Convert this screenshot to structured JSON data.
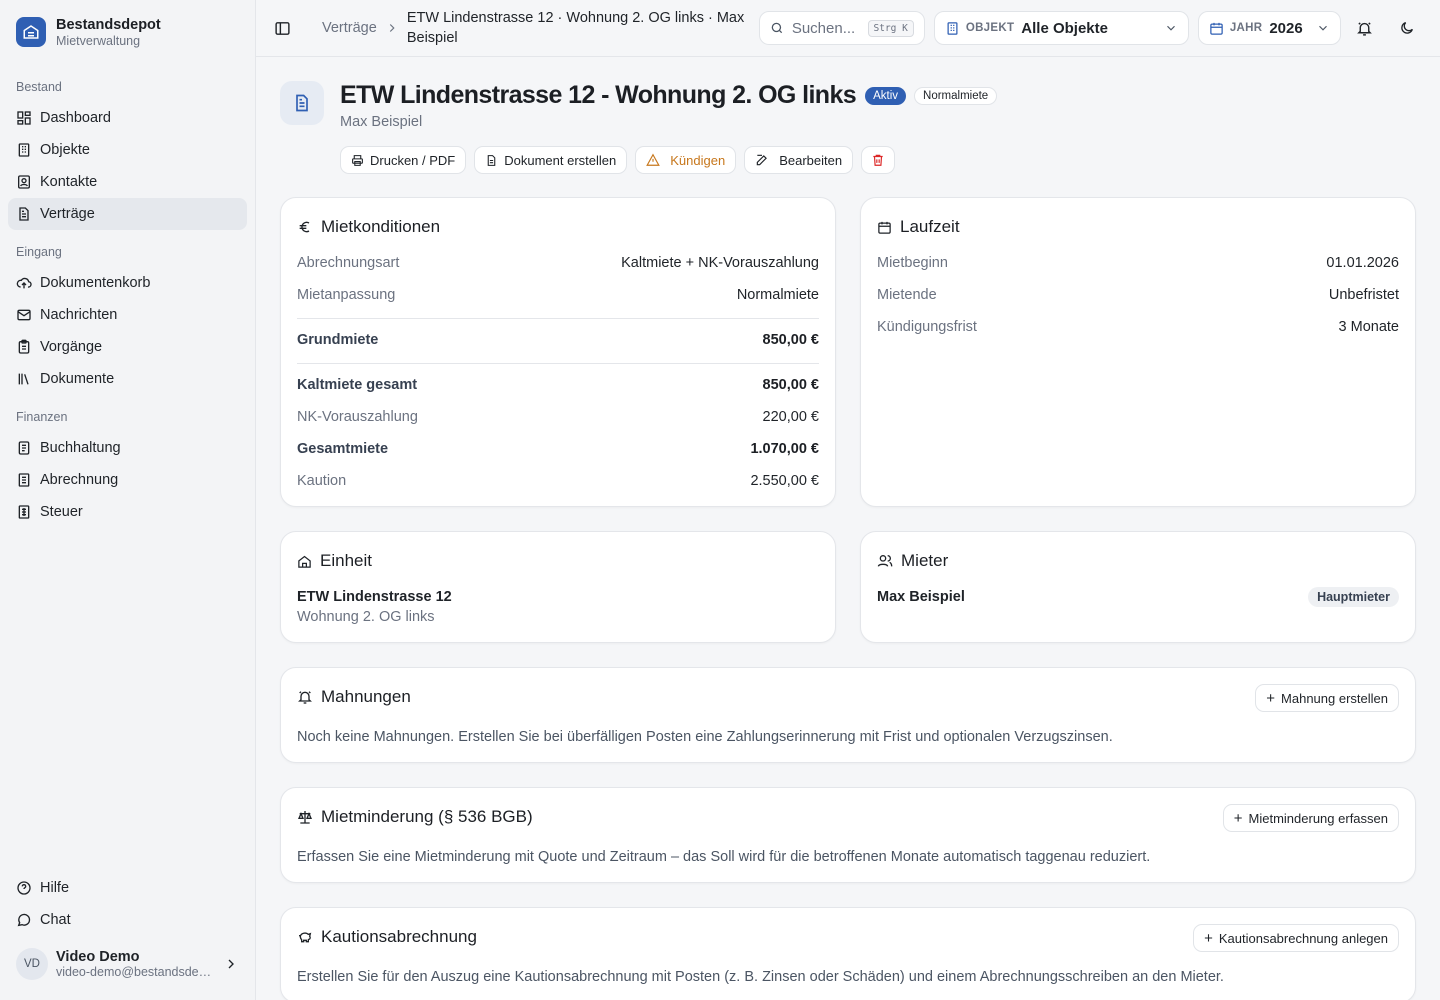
{
  "brand": {
    "title": "Bestandsdepot",
    "subtitle": "Mietverwaltung"
  },
  "nav": {
    "sections": [
      {
        "label": "Bestand",
        "items": [
          "Dashboard",
          "Objekte",
          "Kontakte",
          "Verträge"
        ]
      },
      {
        "label": "Eingang",
        "items": [
          "Dokumentenkorb",
          "Nachrichten",
          "Vorgänge",
          "Dokumente"
        ]
      },
      {
        "label": "Finanzen",
        "items": [
          "Buchhaltung",
          "Abrechnung",
          "Steuer"
        ]
      }
    ],
    "bottom": [
      "Hilfe",
      "Chat"
    ]
  },
  "user": {
    "initials": "VD",
    "name": "Video Demo",
    "email": "video-demo@bestandsdepot.de"
  },
  "topbar": {
    "breadcrumb": [
      "Verträge",
      "ETW Lindenstrasse 12 · Wohnung 2. OG links · Max Beispiel"
    ],
    "search_placeholder": "Suchen...",
    "search_shortcut": "Strg K",
    "object_label": "OBJEKT",
    "object_value": "Alle Objekte",
    "year_label": "JAHR",
    "year_value": "2026"
  },
  "header": {
    "title": "ETW Lindenstrasse 12 - Wohnung 2. OG links",
    "status_badge": "Aktiv",
    "type_badge": "Normalmiete",
    "subtitle": "Max Beispiel",
    "actions": {
      "print": "Drucken / PDF",
      "create_doc": "Dokument erstellen",
      "terminate": "Kündigen",
      "edit": "Bearbeiten"
    }
  },
  "mietkonditionen": {
    "title": "Mietkonditionen",
    "rows": [
      {
        "label": "Abrechnungsart",
        "value": "Kaltmiete + NK-Vorauszahlung"
      },
      {
        "label": "Mietanpassung",
        "value": "Normalmiete"
      },
      {
        "label": "Grundmiete",
        "value": "850,00 €"
      },
      {
        "label": "Kaltmiete gesamt",
        "value": "850,00 €"
      },
      {
        "label": "NK-Vorauszahlung",
        "value": "220,00 €"
      },
      {
        "label": "Gesamtmiete",
        "value": "1.070,00 €"
      },
      {
        "label": "Kaution",
        "value": "2.550,00 €"
      }
    ]
  },
  "laufzeit": {
    "title": "Laufzeit",
    "rows": [
      {
        "label": "Mietbeginn",
        "value": "01.01.2026"
      },
      {
        "label": "Mietende",
        "value": "Unbefristet"
      },
      {
        "label": "Kündigungsfrist",
        "value": "3 Monate"
      }
    ]
  },
  "einheit": {
    "title": "Einheit",
    "name": "ETW Lindenstrasse 12",
    "unit": "Wohnung 2. OG links"
  },
  "mieter": {
    "title": "Mieter",
    "name": "Max Beispiel",
    "role": "Hauptmieter"
  },
  "mahnungen": {
    "title": "Mahnungen",
    "button": "Mahnung erstellen",
    "text": "Noch keine Mahnungen. Erstellen Sie bei überfälligen Posten eine Zahlungserinnerung mit Frist und optionalen Verzugszinsen."
  },
  "mietminderung": {
    "title": "Mietminderung (§ 536 BGB)",
    "button": "Mietminderung erfassen",
    "text": "Erfassen Sie eine Mietminderung mit Quote und Zeitraum – das Soll wird für die betroffenen Monate automatisch taggenau reduziert."
  },
  "kaution": {
    "title": "Kautionsabrechnung",
    "button": "Kautionsabrechnung anlegen",
    "text": "Erstellen Sie für den Auszug eine Kautionsabrechnung mit Posten (z. B. Zinsen oder Schäden) und einem Abrechnungsschreiben an den Mieter."
  },
  "colors": {
    "accent": "#2f5fb3",
    "warning": "#c7771c",
    "danger": "#dc2626"
  }
}
